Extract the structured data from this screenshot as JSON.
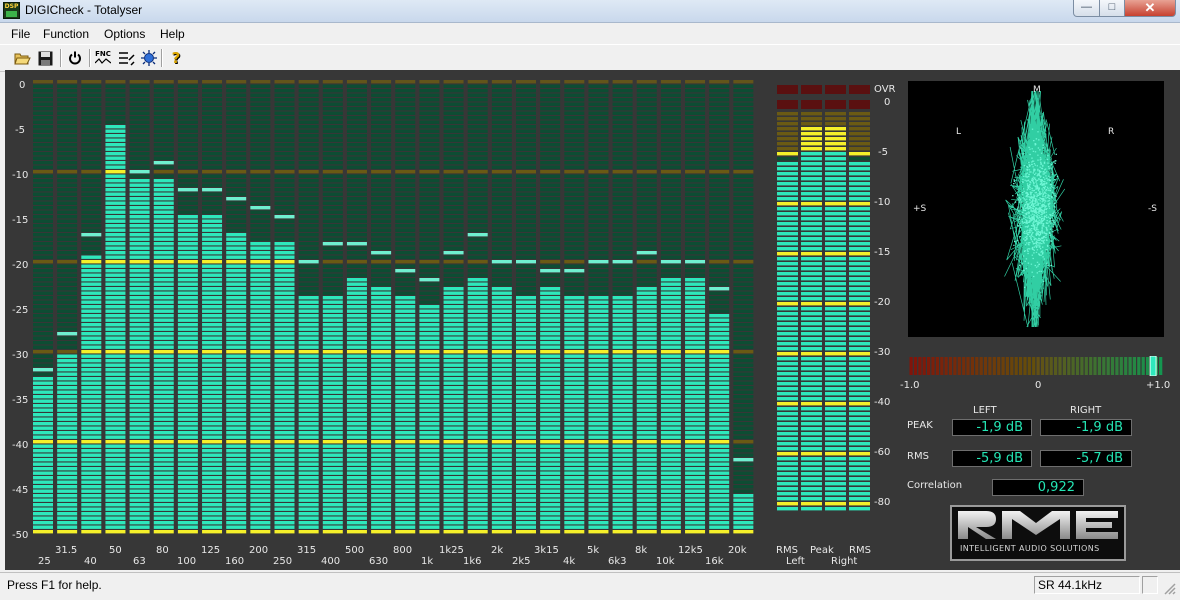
{
  "window": {
    "title": "DIGICheck - Totalyser",
    "app_icon": "digicheck-dsp-icon",
    "app_icon_label": "DSP",
    "minimize_label": "—",
    "maximize_label": "□",
    "close_label": "✕"
  },
  "menu": [
    "File",
    "Function",
    "Options",
    "Help"
  ],
  "toolbar": {
    "buttons": [
      {
        "name": "open-icon"
      },
      {
        "name": "save-icon"
      },
      {
        "name": "power-icon"
      },
      {
        "name": "function-icon",
        "text": "FNC"
      },
      {
        "name": "settings-icon"
      },
      {
        "name": "analyzer-icon"
      },
      {
        "name": "help-icon"
      }
    ]
  },
  "colors": {
    "panel": "#373737",
    "bar_lit": "#2ee8bc",
    "bar_unlit": "#0d4d33",
    "marker_lit": "#f5f02a",
    "marker_unlit": "#6a5a14",
    "peak_hold": "#6ff0d0",
    "top_band": "#63551a",
    "over_band": "#5a1010",
    "readout_text": "#24e6b4"
  },
  "spectrum": {
    "scale_labels": [
      "0",
      "-5",
      "-10",
      "-15",
      "-20",
      "-25",
      "-30",
      "-35",
      "-40",
      "-45",
      "-50"
    ],
    "band_labels": [
      "25",
      "31.5",
      "40",
      "50",
      "63",
      "80",
      "100",
      "125",
      "160",
      "200",
      "250",
      "315",
      "400",
      "500",
      "630",
      "800",
      "1k",
      "1k25",
      "1k6",
      "2k",
      "2k5",
      "3k15",
      "4k",
      "5k",
      "6k3",
      "8k",
      "10k",
      "12k5",
      "16k",
      "20k"
    ],
    "levels_db": [
      -33,
      -30.5,
      -19.5,
      -5,
      -11,
      -11,
      -15,
      -15,
      -17,
      -18,
      -18,
      -24,
      -24,
      -22,
      -23,
      -24,
      -25,
      -23,
      -22,
      -23,
      -24,
      -23,
      -24,
      -24,
      -24,
      -23,
      -22,
      -22,
      -26,
      -46
    ],
    "peaks_db": [
      -32,
      -28,
      -17,
      -5,
      -10,
      -9,
      -12,
      -12,
      -13,
      -14,
      -15,
      -20,
      -18,
      -18,
      -19,
      -21,
      -22,
      -19,
      -17,
      -20,
      -20,
      -21,
      -21,
      -20,
      -20,
      -19,
      -20,
      -20,
      -23,
      -42
    ]
  },
  "meters": {
    "top_label": "OVR",
    "scale_labels": [
      "0",
      "-5",
      "-10",
      "-15",
      "-20",
      "-30",
      "-40",
      "-60",
      "-80"
    ],
    "columns": [
      {
        "label": "RMS",
        "level_db": -6,
        "peak_db": -4.5
      },
      {
        "label": "Peak",
        "level_db": -2.5,
        "peak_db": -2
      },
      {
        "label": "Peak",
        "level_db": -2.5,
        "peak_db": -2
      },
      {
        "label": "RMS",
        "level_db": -6,
        "peak_db": -4.5
      }
    ],
    "channel_labels": [
      "Left",
      "Right"
    ]
  },
  "goniometer": {
    "axis_m": "M",
    "axis_l": "L",
    "axis_r": "R",
    "axis_ps": "+S",
    "axis_ms": "-S",
    "trace_color": "#3af2bf"
  },
  "correlation": {
    "min_label": "-1.0",
    "mid_label": "0",
    "max_label": "+1.0",
    "value_fraction": 0.961
  },
  "readouts": {
    "left_header": "LEFT",
    "right_header": "RIGHT",
    "peak_label": "PEAK",
    "rms_label": "RMS",
    "peak_left": "-1,9 dB",
    "peak_right": "-1,9 dB",
    "rms_left": "-5,9 dB",
    "rms_right": "-5,7 dB",
    "correlation_label": "Correlation",
    "correlation_value": "0,922"
  },
  "logo": {
    "brand": "RME",
    "tagline": "INTELLIGENT AUDIO SOLUTIONS"
  },
  "status": {
    "help_text": "Press F1 for help.",
    "sample_rate": "SR 44.1kHz"
  }
}
